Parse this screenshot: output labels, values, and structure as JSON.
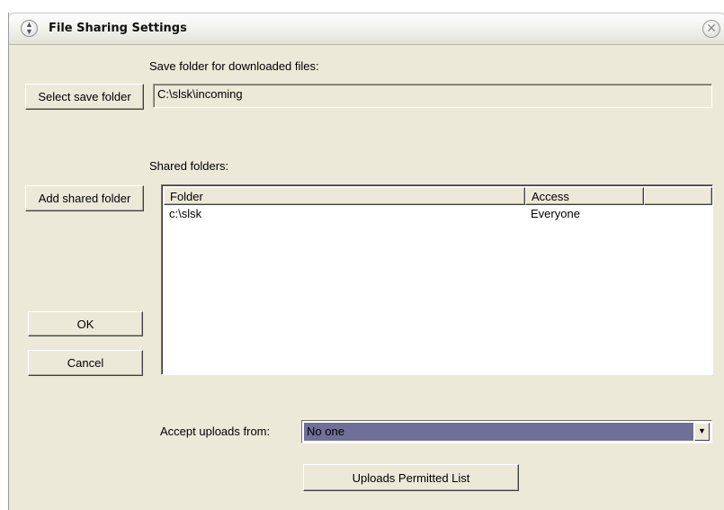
{
  "window": {
    "title": "File Sharing Settings"
  },
  "save_folder": {
    "label": "Save folder for downloaded files:",
    "button_label": "Select save folder",
    "value": "C:\\slsk\\incoming"
  },
  "shared": {
    "label": "Shared folders:",
    "add_button_label": "Add shared folder",
    "columns": [
      "Folder",
      "Access",
      ""
    ],
    "rows": [
      {
        "folder": "c:\\slsk",
        "access": "Everyone"
      }
    ]
  },
  "dialog_buttons": {
    "ok": "OK",
    "cancel": "Cancel"
  },
  "uploads": {
    "label": "Accept uploads from:",
    "selected": "No one",
    "permitted_list_button": "Uploads Permitted List"
  },
  "icons": {
    "collapse": "collapse-chevrons-icon",
    "close": "close-x-icon",
    "dropdown": "dropdown-arrow-icon"
  }
}
